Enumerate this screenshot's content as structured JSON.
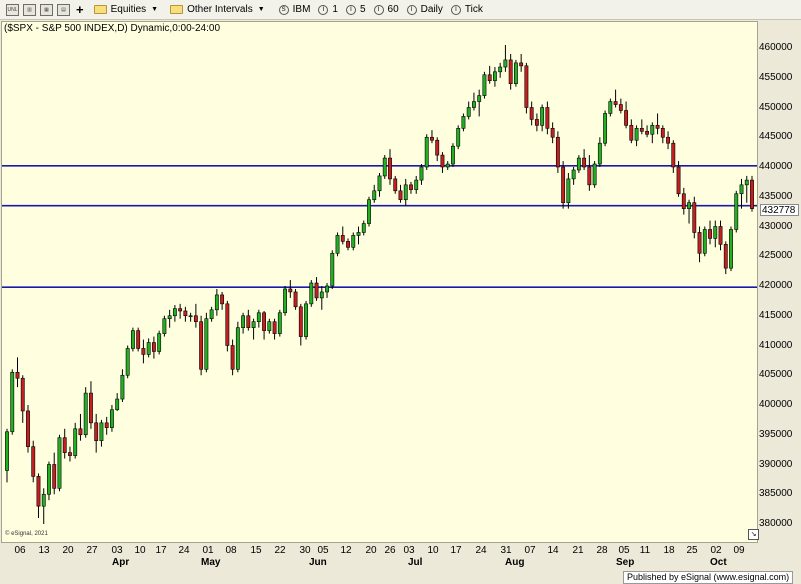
{
  "toolbar": {
    "equities_label": "Equities",
    "intervals_label": "Other Intervals",
    "symbol_label": "IBM",
    "interval_buttons": [
      "1",
      "5",
      "60",
      "Daily",
      "Tick"
    ],
    "left_icons": [
      "unlink-icon",
      "chart-icon",
      "layout-icon",
      "print-icon",
      "add-icon"
    ]
  },
  "chart_data": {
    "type": "candlestick",
    "title": "($SPX - S&P 500 INDEX,D) Dynamic,0:00-24:00",
    "ylim": [
      3770,
      4620
    ],
    "yticks": [
      3800,
      3850,
      3900,
      3950,
      4000,
      4050,
      4100,
      4150,
      4200,
      4250,
      4300,
      4350,
      4400,
      4450,
      4500,
      4550,
      4600
    ],
    "ytick_labels": [
      "380000",
      "385000",
      "390000",
      "395000",
      "400000",
      "405000",
      "410000",
      "415000",
      "420000",
      "425000",
      "430000",
      "435000",
      "440000",
      "445000",
      "450000",
      "455000",
      "460000"
    ],
    "last_price": 4327.78,
    "last_price_label": "432778",
    "horizontal_lines": [
      4402,
      4335,
      4198
    ],
    "line_color": "#1a1aaa",
    "up_color": "#22b022",
    "down_color": "#c42020",
    "background": "#ffffe0",
    "x_tick_labels": [
      "06",
      "13",
      "20",
      "27",
      "03",
      "10",
      "17",
      "24",
      "01",
      "08",
      "15",
      "22",
      "30",
      "05",
      "12",
      "20",
      "26",
      "03",
      "10",
      "17",
      "24",
      "31",
      "07",
      "14",
      "21",
      "28",
      "05",
      "11",
      "18",
      "25",
      "02",
      "09"
    ],
    "months": [
      "Apr",
      "May",
      "Jun",
      "Jul",
      "Aug",
      "Sep",
      "Oct"
    ],
    "ohlc": [
      [
        3890,
        3960,
        3870,
        3955
      ],
      [
        3955,
        4060,
        3950,
        4055
      ],
      [
        4055,
        4080,
        4030,
        4045
      ],
      [
        4045,
        4050,
        3970,
        3990
      ],
      [
        3990,
        4000,
        3920,
        3930
      ],
      [
        3930,
        3940,
        3870,
        3880
      ],
      [
        3880,
        3885,
        3810,
        3830
      ],
      [
        3830,
        3860,
        3800,
        3850
      ],
      [
        3850,
        3905,
        3840,
        3900
      ],
      [
        3900,
        3920,
        3850,
        3860
      ],
      [
        3860,
        3950,
        3855,
        3945
      ],
      [
        3945,
        3960,
        3910,
        3920
      ],
      [
        3920,
        3930,
        3905,
        3915
      ],
      [
        3915,
        3970,
        3910,
        3960
      ],
      [
        3960,
        3985,
        3940,
        3950
      ],
      [
        3950,
        4030,
        3945,
        4020
      ],
      [
        4020,
        4040,
        3960,
        3970
      ],
      [
        3970,
        3985,
        3920,
        3940
      ],
      [
        3940,
        3975,
        3930,
        3970
      ],
      [
        3970,
        3980,
        3950,
        3962
      ],
      [
        3962,
        4000,
        3955,
        3992
      ],
      [
        3992,
        4020,
        3990,
        4010
      ],
      [
        4010,
        4060,
        4005,
        4050
      ],
      [
        4050,
        4100,
        4045,
        4095
      ],
      [
        4095,
        4130,
        4090,
        4125
      ],
      [
        4125,
        4130,
        4090,
        4095
      ],
      [
        4095,
        4110,
        4070,
        4085
      ],
      [
        4085,
        4112,
        4080,
        4105
      ],
      [
        4105,
        4115,
        4078,
        4090
      ],
      [
        4090,
        4125,
        4085,
        4120
      ],
      [
        4120,
        4150,
        4115,
        4145
      ],
      [
        4145,
        4160,
        4130,
        4150
      ],
      [
        4150,
        4168,
        4140,
        4162
      ],
      [
        4162,
        4170,
        4145,
        4158
      ],
      [
        4158,
        4165,
        4140,
        4150
      ],
      [
        4150,
        4155,
        4140,
        4150
      ],
      [
        4150,
        4170,
        4130,
        4140
      ],
      [
        4140,
        4150,
        4050,
        4060
      ],
      [
        4060,
        4155,
        4055,
        4145
      ],
      [
        4145,
        4165,
        4140,
        4160
      ],
      [
        4160,
        4195,
        4150,
        4185
      ],
      [
        4185,
        4190,
        4160,
        4170
      ],
      [
        4170,
        4175,
        4090,
        4100
      ],
      [
        4100,
        4110,
        4050,
        4060
      ],
      [
        4060,
        4140,
        4055,
        4130
      ],
      [
        4130,
        4155,
        4120,
        4150
      ],
      [
        4150,
        4160,
        4125,
        4130
      ],
      [
        4130,
        4145,
        4110,
        4140
      ],
      [
        4140,
        4160,
        4130,
        4155
      ],
      [
        4155,
        4158,
        4110,
        4125
      ],
      [
        4125,
        4145,
        4120,
        4140
      ],
      [
        4140,
        4145,
        4110,
        4120
      ],
      [
        4120,
        4160,
        4115,
        4155
      ],
      [
        4155,
        4200,
        4150,
        4195
      ],
      [
        4195,
        4210,
        4180,
        4190
      ],
      [
        4190,
        4195,
        4160,
        4165
      ],
      [
        4165,
        4170,
        4100,
        4115
      ],
      [
        4115,
        4175,
        4110,
        4170
      ],
      [
        4170,
        4210,
        4165,
        4205
      ],
      [
        4205,
        4215,
        4175,
        4180
      ],
      [
        4180,
        4200,
        4160,
        4190
      ],
      [
        4190,
        4205,
        4180,
        4200
      ],
      [
        4200,
        4260,
        4195,
        4255
      ],
      [
        4255,
        4290,
        4250,
        4285
      ],
      [
        4285,
        4300,
        4270,
        4275
      ],
      [
        4275,
        4280,
        4260,
        4265
      ],
      [
        4265,
        4290,
        4260,
        4285
      ],
      [
        4285,
        4300,
        4270,
        4290
      ],
      [
        4290,
        4310,
        4285,
        4305
      ],
      [
        4305,
        4350,
        4300,
        4345
      ],
      [
        4345,
        4370,
        4340,
        4360
      ],
      [
        4360,
        4390,
        4350,
        4385
      ],
      [
        4385,
        4420,
        4380,
        4415
      ],
      [
        4415,
        4430,
        4370,
        4380
      ],
      [
        4380,
        4385,
        4355,
        4360
      ],
      [
        4360,
        4370,
        4340,
        4345
      ],
      [
        4345,
        4380,
        4335,
        4370
      ],
      [
        4370,
        4375,
        4355,
        4362
      ],
      [
        4362,
        4385,
        4355,
        4378
      ],
      [
        4378,
        4405,
        4370,
        4400
      ],
      [
        4400,
        4455,
        4395,
        4450
      ],
      [
        4450,
        4462,
        4440,
        4445
      ],
      [
        4445,
        4450,
        4410,
        4420
      ],
      [
        4420,
        4425,
        4390,
        4400
      ],
      [
        4400,
        4410,
        4395,
        4405
      ],
      [
        4405,
        4440,
        4400,
        4435
      ],
      [
        4435,
        4470,
        4430,
        4465
      ],
      [
        4465,
        4490,
        4460,
        4485
      ],
      [
        4485,
        4510,
        4480,
        4500
      ],
      [
        4500,
        4525,
        4495,
        4510
      ],
      [
        4510,
        4530,
        4485,
        4520
      ],
      [
        4520,
        4560,
        4515,
        4555
      ],
      [
        4555,
        4570,
        4540,
        4545
      ],
      [
        4545,
        4568,
        4535,
        4560
      ],
      [
        4560,
        4575,
        4550,
        4568
      ],
      [
        4568,
        4605,
        4560,
        4580
      ],
      [
        4580,
        4590,
        4530,
        4540
      ],
      [
        4540,
        4580,
        4535,
        4575
      ],
      [
        4575,
        4590,
        4560,
        4570
      ],
      [
        4570,
        4575,
        4490,
        4500
      ],
      [
        4500,
        4510,
        4470,
        4480
      ],
      [
        4480,
        4490,
        4460,
        4470
      ],
      [
        4470,
        4505,
        4460,
        4500
      ],
      [
        4500,
        4510,
        4455,
        4465
      ],
      [
        4465,
        4475,
        4440,
        4450
      ],
      [
        4450,
        4460,
        4390,
        4400
      ],
      [
        4400,
        4410,
        4330,
        4340
      ],
      [
        4340,
        4390,
        4330,
        4380
      ],
      [
        4380,
        4400,
        4370,
        4395
      ],
      [
        4395,
        4420,
        4390,
        4415
      ],
      [
        4415,
        4430,
        4395,
        4400
      ],
      [
        4400,
        4420,
        4360,
        4370
      ],
      [
        4370,
        4410,
        4365,
        4405
      ],
      [
        4405,
        4450,
        4400,
        4440
      ],
      [
        4440,
        4495,
        4435,
        4490
      ],
      [
        4490,
        4515,
        4485,
        4510
      ],
      [
        4510,
        4530,
        4500,
        4505
      ],
      [
        4505,
        4515,
        4490,
        4495
      ],
      [
        4495,
        4510,
        4465,
        4470
      ],
      [
        4470,
        4480,
        4440,
        4445
      ],
      [
        4445,
        4470,
        4435,
        4465
      ],
      [
        4465,
        4480,
        4455,
        4460
      ],
      [
        4460,
        4470,
        4450,
        4455
      ],
      [
        4455,
        4475,
        4440,
        4470
      ],
      [
        4470,
        4490,
        4455,
        4465
      ],
      [
        4465,
        4470,
        4440,
        4450
      ],
      [
        4450,
        4460,
        4430,
        4440
      ],
      [
        4440,
        4445,
        4390,
        4400
      ],
      [
        4400,
        4410,
        4350,
        4355
      ],
      [
        4355,
        4365,
        4320,
        4330
      ],
      [
        4330,
        4345,
        4305,
        4340
      ],
      [
        4340,
        4350,
        4280,
        4290
      ],
      [
        4290,
        4300,
        4240,
        4255
      ],
      [
        4255,
        4300,
        4250,
        4295
      ],
      [
        4295,
        4310,
        4270,
        4280
      ],
      [
        4280,
        4310,
        4265,
        4300
      ],
      [
        4300,
        4310,
        4260,
        4270
      ],
      [
        4270,
        4275,
        4220,
        4230
      ],
      [
        4230,
        4300,
        4225,
        4295
      ],
      [
        4295,
        4360,
        4290,
        4355
      ],
      [
        4355,
        4380,
        4330,
        4370
      ],
      [
        4370,
        4385,
        4340,
        4378
      ],
      [
        4378,
        4385,
        4325,
        4330
      ]
    ]
  },
  "footer": {
    "watermark": "© eSignal, 2021",
    "published": "Published by eSignal (www.esignal.com)"
  }
}
